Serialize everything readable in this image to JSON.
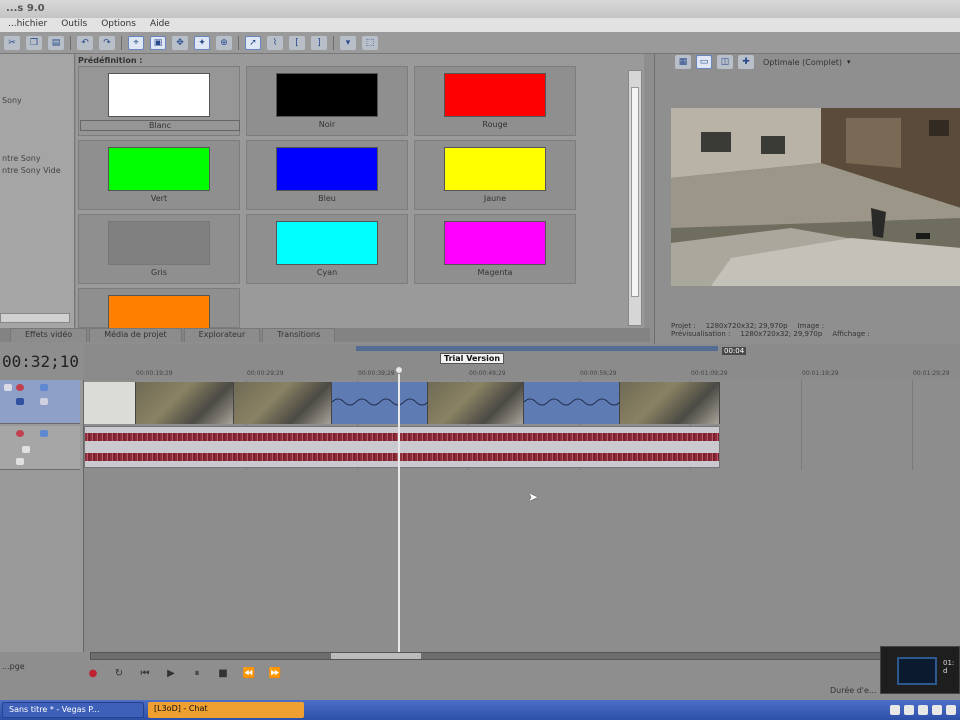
{
  "window": {
    "title": "...s 9.0"
  },
  "menu": [
    "...hichier",
    "Outils",
    "Options",
    "Aide"
  ],
  "toolbar": {
    "icons": [
      "cut-icon",
      "copy-icon",
      "paste-icon",
      "undo-icon",
      "redo-icon",
      "snap-icon",
      "lock-icon",
      "edit-tool-icon",
      "envelope-icon",
      "zoom-icon",
      "select-icon",
      "split-icon",
      "trim-start-icon",
      "trim-end-icon",
      "marker-icon",
      "region-icon"
    ]
  },
  "explorer": {
    "items": [
      "Sony",
      "ntre Sony",
      "ntre Sony Vide"
    ]
  },
  "presets": {
    "title": "Prédéfinition :",
    "items": [
      {
        "label": "Blanc",
        "color": "#ffffff",
        "selected": true
      },
      {
        "label": "Noir",
        "color": "#000000"
      },
      {
        "label": "Rouge",
        "color": "#ff0000"
      },
      {
        "label": "Vert",
        "color": "#00ff00"
      },
      {
        "label": "Bleu",
        "color": "#0000ff"
      },
      {
        "label": "Jaune",
        "color": "#ffff00"
      },
      {
        "label": "Gris",
        "color": "#808080"
      },
      {
        "label": "Cyan",
        "color": "#00ffff"
      },
      {
        "label": "Magenta",
        "color": "#ff00ff"
      },
      {
        "label": "",
        "color": "#ff8000"
      }
    ]
  },
  "tabs": [
    "Effets vidéo",
    "Média de projet",
    "Explorateur",
    "Transitions"
  ],
  "preview": {
    "quality": "Optimale (Complet)",
    "info": [
      {
        "label": "Projet :",
        "value": "1280x720x32; 29,970p",
        "label2": "Image :",
        "value2": ""
      },
      {
        "label": "Prévisualisation :",
        "value": "1280x720x32; 29,970p",
        "label2": "Affichage :",
        "value2": ""
      }
    ]
  },
  "timeline": {
    "timecode": "00:32;10",
    "trial_label": "Trial Version",
    "end_marker": "00:04",
    "ticks": [
      "00:00:19;29",
      "00:00:29;29",
      "00:00:39;29",
      "00:00:49;29",
      "00:00:59;29",
      "00:01:09;29",
      "00:01:19;29",
      "00:01:29;29"
    ]
  },
  "bottom": {
    "left_label": "...pge"
  },
  "status": {
    "text": "Durée d'e..."
  },
  "notification": {
    "time": "01:",
    "sub": "d"
  },
  "taskbar": {
    "tasks": [
      "Sans titre * - Vegas P...",
      "[L3oD] - Chat"
    ]
  },
  "colors": {
    "accent": "#2c4fa8",
    "clip_blue": "#5f7bb4",
    "waveform": "#8b2d3a"
  }
}
